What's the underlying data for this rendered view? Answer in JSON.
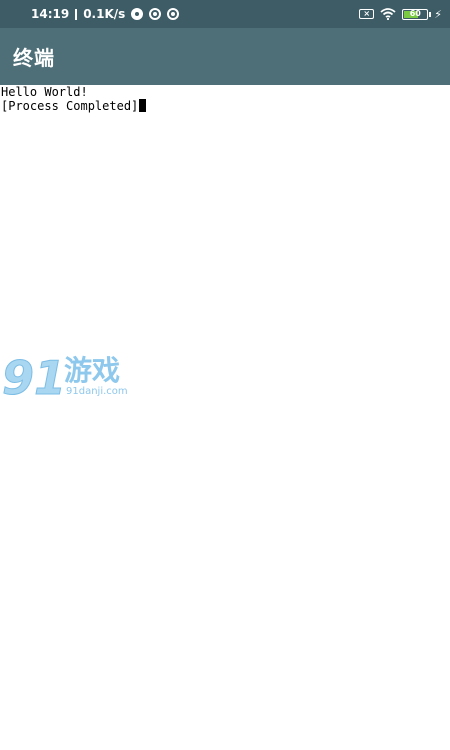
{
  "status_bar": {
    "time": "14:19",
    "network_speed": "0.1K/s",
    "battery_level": "60",
    "icons": [
      "data-saver-icon",
      "notification-icon",
      "notification-icon",
      "no-sim-icon",
      "wifi-icon",
      "battery-icon",
      "charging-icon"
    ],
    "bg_color": "#3d5c66"
  },
  "app_bar": {
    "title": "终端",
    "bg_color": "#4e6f78"
  },
  "terminal": {
    "lines": [
      "Hello World!",
      "[Process Completed]"
    ]
  },
  "watermark": {
    "logo_text": "91游戏",
    "domain": "91danji.com"
  }
}
